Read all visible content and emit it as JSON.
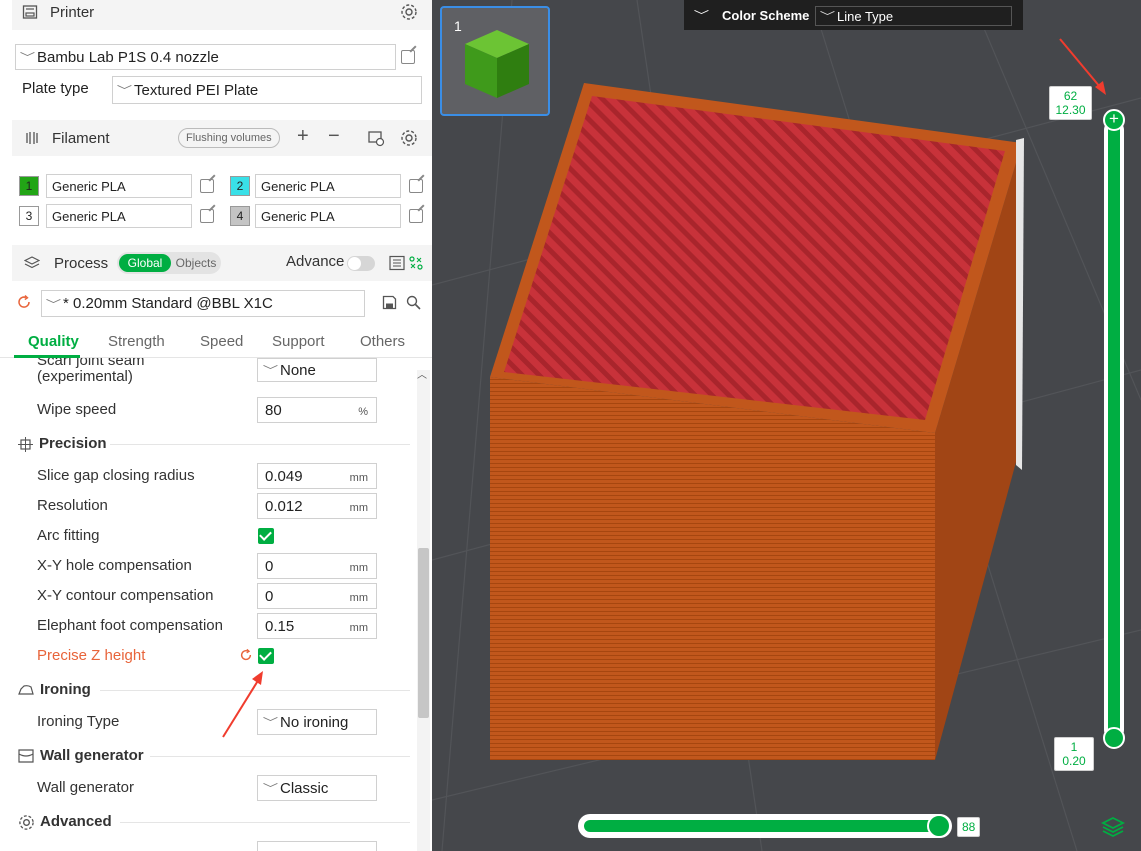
{
  "printer": {
    "section_title": "Printer",
    "model": "Bambu Lab P1S 0.4 nozzle",
    "plate_type_label": "Plate type",
    "plate_type_value": "Textured PEI Plate"
  },
  "filament": {
    "section_title": "Filament",
    "flushing_label": "Flushing volumes",
    "add_symbol": "+",
    "remove_symbol": "−",
    "slots": [
      {
        "num": "1",
        "name": "Generic PLA",
        "color": "#22a516",
        "text": "#222"
      },
      {
        "num": "2",
        "name": "Generic PLA",
        "color": "#39e0e8",
        "text": "#222"
      },
      {
        "num": "3",
        "name": "Generic PLA",
        "color": "#ffffff",
        "text": "#222"
      },
      {
        "num": "4",
        "name": "Generic PLA",
        "color": "#c4c4c4",
        "text": "#222"
      }
    ]
  },
  "process": {
    "section_title": "Process",
    "toggle_global": "Global",
    "toggle_objects": "Objects",
    "advance_label": "Advance",
    "preset": "* 0.20mm Standard @BBL X1C",
    "tabs": [
      "Quality",
      "Strength",
      "Speed",
      "Support",
      "Others"
    ],
    "active_tab": "Quality"
  },
  "settings": {
    "seam_label": "Scarf joint seam (experimental)",
    "seam_value": "None",
    "wipe_speed_label": "Wipe speed",
    "wipe_speed_value": "80",
    "wipe_speed_unit": "%",
    "precision_title": "Precision",
    "slice_gap_label": "Slice gap closing radius",
    "slice_gap_value": "0.049",
    "resolution_label": "Resolution",
    "resolution_value": "0.012",
    "arc_fitting_label": "Arc fitting",
    "xy_hole_label": "X-Y hole compensation",
    "xy_hole_value": "0",
    "xy_contour_label": "X-Y contour compensation",
    "xy_contour_value": "0",
    "elephant_label": "Elephant foot compensation",
    "elephant_value": "0.15",
    "precise_z_label": "Precise Z height",
    "ironing_title": "Ironing",
    "ironing_type_label": "Ironing Type",
    "ironing_type_value": "No ironing",
    "wall_gen_title": "Wall generator",
    "wall_gen_label": "Wall generator",
    "wall_gen_value": "Classic",
    "advanced_title": "Advanced",
    "unit_mm": "mm"
  },
  "viewport": {
    "plate_number": "1",
    "color_scheme_label": "Color Scheme",
    "color_scheme_value": "Line Type",
    "top_layer": "62",
    "top_height": "12.30",
    "bottom_layer": "1",
    "bottom_height": "0.20",
    "horizontal_value": "88"
  },
  "colors": {
    "accent": "#00ae42",
    "modified": "#e8643a",
    "model_wall": "#c1571c",
    "model_top": "#c8323a"
  }
}
